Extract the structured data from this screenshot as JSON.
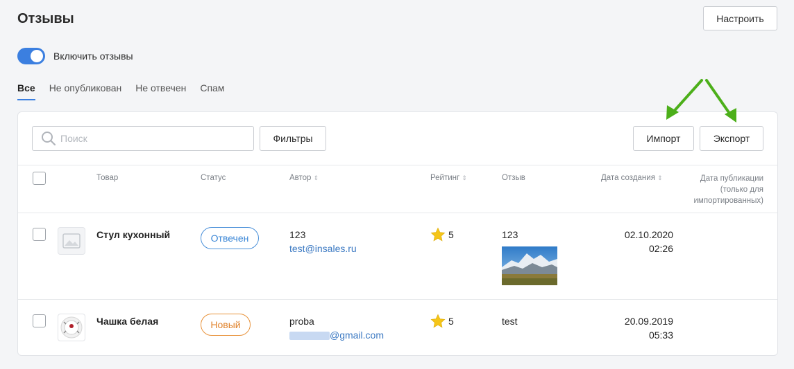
{
  "header": {
    "title": "Отзывы",
    "configure_label": "Настроить"
  },
  "toggle": {
    "label": "Включить отзывы",
    "on": true
  },
  "tabs": [
    {
      "label": "Все",
      "active": true
    },
    {
      "label": "Не опубликован",
      "active": false
    },
    {
      "label": "Не отвечен",
      "active": false
    },
    {
      "label": "Спам",
      "active": false
    }
  ],
  "toolbar": {
    "search_placeholder": "Поиск",
    "filters_label": "Фильтры",
    "import_label": "Импорт",
    "export_label": "Экспорт"
  },
  "table": {
    "columns": {
      "product": "Товар",
      "status": "Статус",
      "author": "Автор",
      "rating": "Рейтинг",
      "review": "Отзыв",
      "created": "Дата создания",
      "published_line1": "Дата публикации",
      "published_line2": "(только для",
      "published_line3": "импортированных)"
    },
    "rows": [
      {
        "product": "Стул кухонный",
        "status": "Отвечен",
        "author_name": "123",
        "author_email": "test@insales.ru",
        "rating": "5",
        "review": "123",
        "created_date": "02.10.2020",
        "created_time": "02:26"
      },
      {
        "product": "Чашка белая",
        "status": "Новый",
        "author_name": "proba",
        "author_email": "@gmail.com",
        "rating": "5",
        "review": "test",
        "created_date": "20.09.2019",
        "created_time": "05:33"
      }
    ]
  },
  "colors": {
    "accent": "#3b7fe0",
    "answered": "#4a90d9",
    "new": "#e8923a",
    "star": "#f5c518",
    "annotation_arrow": "#4caf1a"
  },
  "icons": [
    "search-icon",
    "image-placeholder-icon",
    "star-icon",
    "arrow-annotation-icon"
  ]
}
